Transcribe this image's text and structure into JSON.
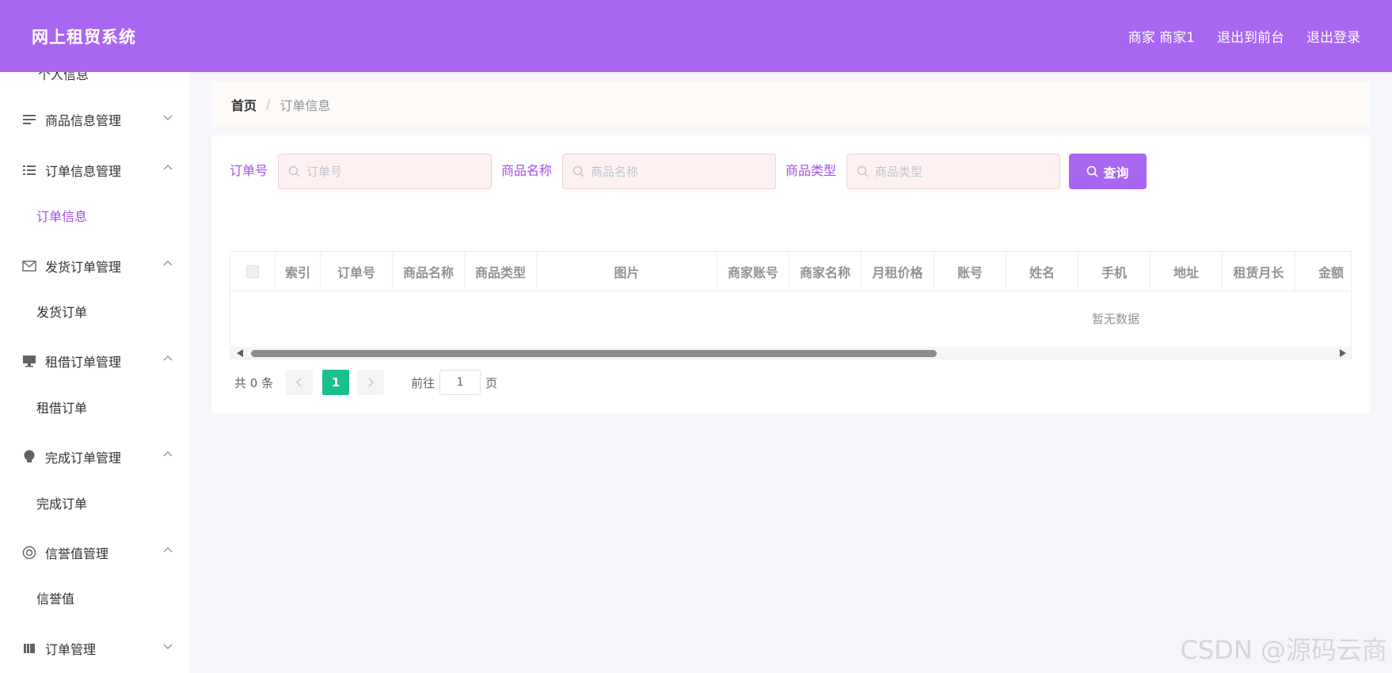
{
  "header": {
    "brand": "网上租贸系统",
    "user_label": "商家 商家1",
    "to_front_label": "退出到前台",
    "logout_label": "退出登录"
  },
  "sidebar": {
    "cut_item": "个人信息",
    "items": [
      {
        "label": "商品信息管理",
        "icon": "list-lines-icon",
        "expanded": false
      },
      {
        "label": "订单信息管理",
        "icon": "list-bullets-icon",
        "expanded": true,
        "sub": "订单信息"
      },
      {
        "label": "发货订单管理",
        "icon": "mail-icon",
        "expanded": true,
        "sub": "发货订单"
      },
      {
        "label": "租借订单管理",
        "icon": "monitor-icon",
        "expanded": true,
        "sub": "租借订单"
      },
      {
        "label": "完成订单管理",
        "icon": "bulb-icon",
        "expanded": true,
        "sub": "完成订单"
      },
      {
        "label": "信誉值管理",
        "icon": "lifebuoy-icon",
        "expanded": true,
        "sub": "信誉值"
      },
      {
        "label": "订单管理",
        "icon": "collection-icon",
        "expanded": false
      }
    ]
  },
  "breadcrumb": {
    "home": "首页",
    "separator": "/",
    "current": "订单信息"
  },
  "search": {
    "order_no_label": "订单号",
    "order_no_placeholder": "订单号",
    "goods_name_label": "商品名称",
    "goods_name_placeholder": "商品名称",
    "goods_type_label": "商品类型",
    "goods_type_placeholder": "商品类型",
    "query_label": "查询"
  },
  "table": {
    "columns": [
      "索引",
      "订单号",
      "商品名称",
      "商品类型",
      "图片",
      "商家账号",
      "商家名称",
      "月租价格",
      "账号",
      "姓名",
      "手机",
      "地址",
      "租赁月长",
      "金额"
    ],
    "empty_text": "暂无数据"
  },
  "pagination": {
    "total_text": "共 0 条",
    "current_page": "1",
    "goto_label": "前往",
    "goto_value": "1",
    "page_unit": "页"
  },
  "watermark": "CSDN @源码云商",
  "colors": {
    "accent": "#a966f1",
    "active_text": "#a14fe6",
    "page_active": "#1bbf8f"
  }
}
